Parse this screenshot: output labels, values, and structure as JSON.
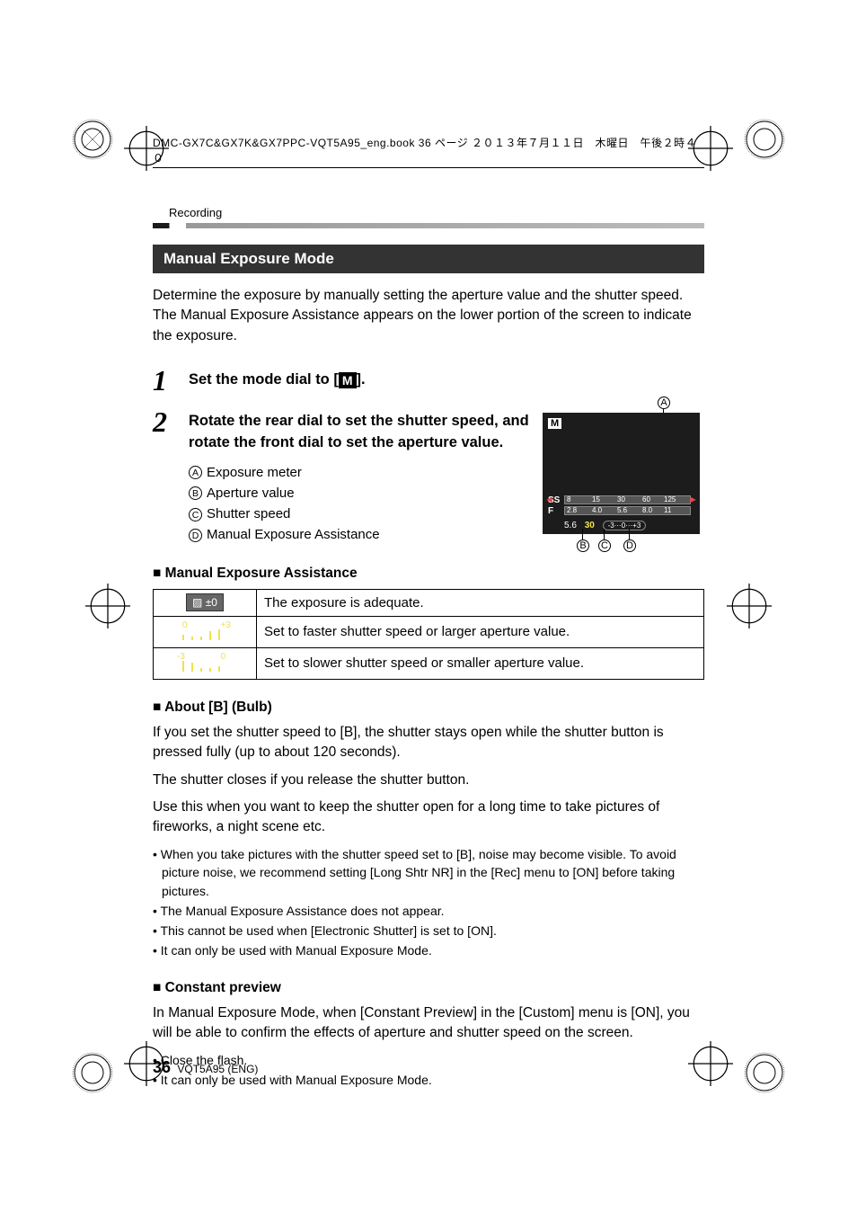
{
  "header_line": "DMC-GX7C&GX7K&GX7PPC-VQT5A95_eng.book  36 ページ  ２０１３年７月１１日　木曜日　午後２時４０",
  "section_label": "Recording",
  "title_bar": "Manual Exposure Mode",
  "intro": "Determine the exposure by manually setting the aperture value and the shutter speed. The Manual Exposure Assistance appears on the lower portion of the screen to indicate the exposure.",
  "step1": {
    "num": "1",
    "title_pre": "Set the mode dial to [",
    "title_post": "].",
    "m_glyph": "M"
  },
  "step2": {
    "num": "2",
    "title": "Rotate the rear dial to set the shutter speed, and rotate the front dial to set the aperture value.",
    "items": {
      "a": "Exposure meter",
      "b": "Aperture value",
      "c": "Shutter speed",
      "d": "Manual Exposure Assistance"
    }
  },
  "cam": {
    "mode": "M",
    "ss_label": "SS",
    "f_label": "F",
    "ss_ticks": [
      "8",
      "15",
      "30",
      "60",
      "125"
    ],
    "f_ticks": [
      "2.8",
      "4.0",
      "5.6",
      "8.0",
      "11"
    ],
    "f_val": "5.6",
    "shutter_val": "30",
    "meter": "0",
    "callouts": {
      "a": "A",
      "b": "B",
      "c": "C",
      "d": "D"
    }
  },
  "assist_heading": "Manual Exposure Assistance",
  "assist_table": {
    "r1_icon": "±0",
    "r1": "The exposure is adequate.",
    "r2": "Set to faster shutter speed or larger aperture value.",
    "r3": "Set to slower shutter speed or smaller aperture value."
  },
  "bulb_heading": "About [B] (Bulb)",
  "bulb_p1": "If you set the shutter speed to [B], the shutter stays open while the shutter button is pressed fully (up to about 120 seconds).",
  "bulb_p2": "The shutter closes if you release the shutter button.",
  "bulb_p3": "Use this when you want to keep the shutter open for a long time to take pictures of fireworks, a night scene etc.",
  "bulb_bullets": [
    "When you take pictures with the shutter speed set to [B], noise may become visible. To avoid picture noise, we recommend setting [Long Shtr NR] in the [Rec] menu to [ON] before taking pictures.",
    "The Manual Exposure Assistance does not appear.",
    "This cannot be used when [Electronic Shutter] is set to [ON].",
    "It can only be used with Manual Exposure Mode."
  ],
  "preview_heading": "Constant preview",
  "preview_p1": "In Manual Exposure Mode, when [Constant Preview] in the [Custom] menu is [ON], you will be able to confirm the effects of aperture and shutter speed on the screen.",
  "preview_bullets": [
    "Close the flash.",
    "It can only be used with Manual Exposure Mode."
  ],
  "footer": {
    "page": "36",
    "code": "VQT5A95 (ENG)"
  }
}
